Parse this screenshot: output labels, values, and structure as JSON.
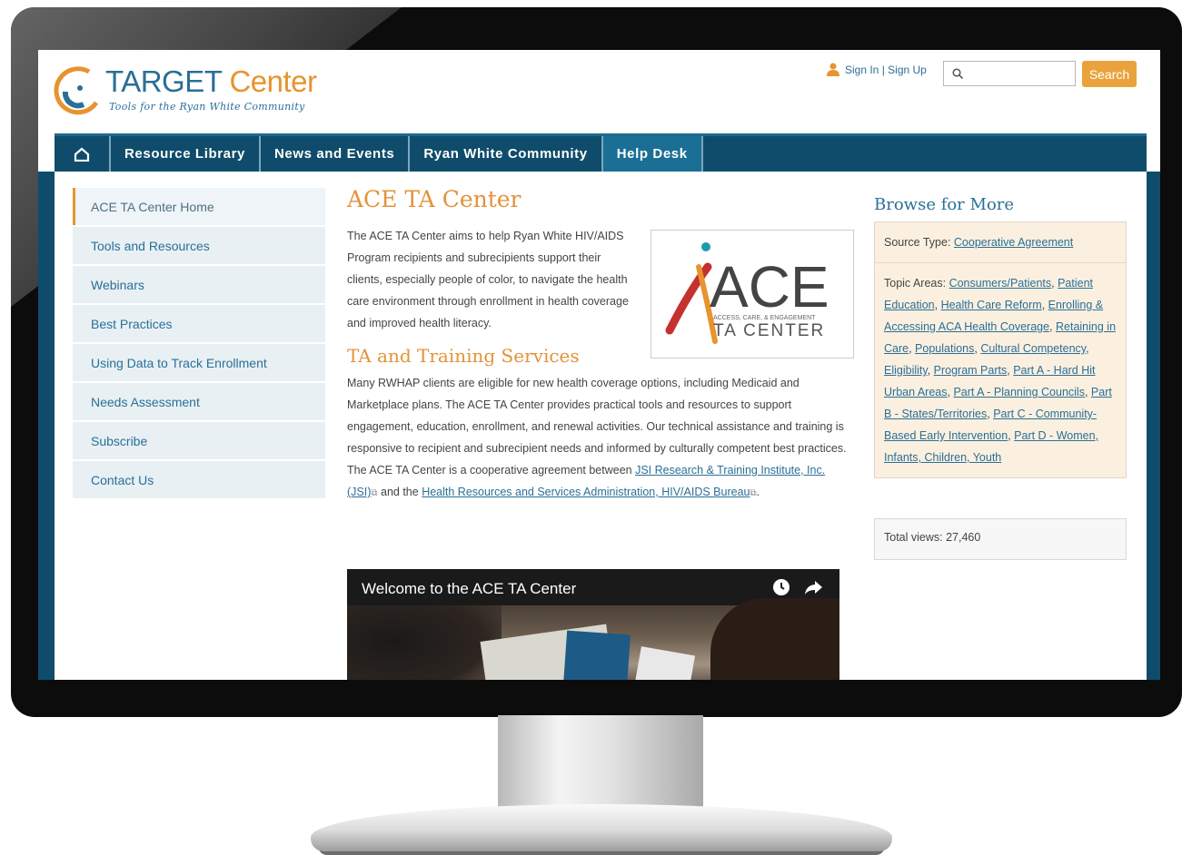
{
  "header": {
    "logo_title_part1": "TARGET",
    "logo_title_part2": "Center",
    "logo_tagline": "Tools for the Ryan White Community",
    "signin_label": "Sign In | Sign Up",
    "search_placeholder": "",
    "search_button": "Search"
  },
  "nav": {
    "items": [
      {
        "label": "Resource Library"
      },
      {
        "label": "News and Events"
      },
      {
        "label": "Ryan White Community"
      },
      {
        "label": "Help Desk"
      }
    ]
  },
  "sidebar": {
    "items": [
      {
        "label": "ACE TA Center Home"
      },
      {
        "label": "Tools and Resources"
      },
      {
        "label": "Webinars"
      },
      {
        "label": "Best Practices"
      },
      {
        "label": "Using Data to Track Enrollment"
      },
      {
        "label": "Needs Assessment"
      },
      {
        "label": "Subscribe"
      },
      {
        "label": "Contact Us"
      }
    ]
  },
  "main": {
    "title": "ACE TA Center",
    "intro": "The ACE TA Center aims to help Ryan White HIV/AIDS Program recipients and subrecipients support their clients, especially people of color, to navigate the health care environment through enrollment in health coverage and improved health literacy.",
    "section_title": "TA and Training Services",
    "body_part1": "Many RWHAP clients are eligible for new health coverage options, including Medicaid and Marketplace plans. The ACE TA Center provides practical tools and resources to support engagement, education, enrollment, and renewal activities. Our technical assistance and training is responsive to recipient and subrecipient needs and informed by culturally competent best practices. The ACE TA Center is a cooperative agreement between ",
    "link_jsi": "JSI Research & Training Institute, Inc. (JSI)",
    "body_part2": " and the ",
    "link_hrsa": "Health Resources and Services Administration, HIV/AIDS Bureau",
    "body_part3": ".",
    "ace_logo_text": "ACE",
    "ace_logo_sub": "ACCESS, CARE, & ENGAGEMENT",
    "ace_logo_ta": "TA CENTER",
    "video_title": "Welcome to the ACE TA Center"
  },
  "browse": {
    "title": "Browse for More",
    "source_label": "Source Type: ",
    "source_link": "Cooperative Agreement",
    "topic_label": "Topic Areas: ",
    "topics": [
      "Consumers/Patients",
      "Patient Education",
      "Health Care Reform",
      "Enrolling & Accessing ACA Health Coverage",
      "Retaining in Care",
      "Populations",
      "Cultural Competency",
      "Eligibility",
      "Program Parts",
      "Part A - Hard Hit Urban Areas",
      "Part A - Planning Councils",
      "Part B - States/Territories",
      "Part C - Community-Based Early Intervention",
      "Part D - Women, Infants, Children, Youth"
    ],
    "views": "Total views: 27,460"
  },
  "colors": {
    "nav_bg": "#0f4c6b",
    "accent_orange": "#e8932e",
    "link_blue": "#2a6f97"
  }
}
